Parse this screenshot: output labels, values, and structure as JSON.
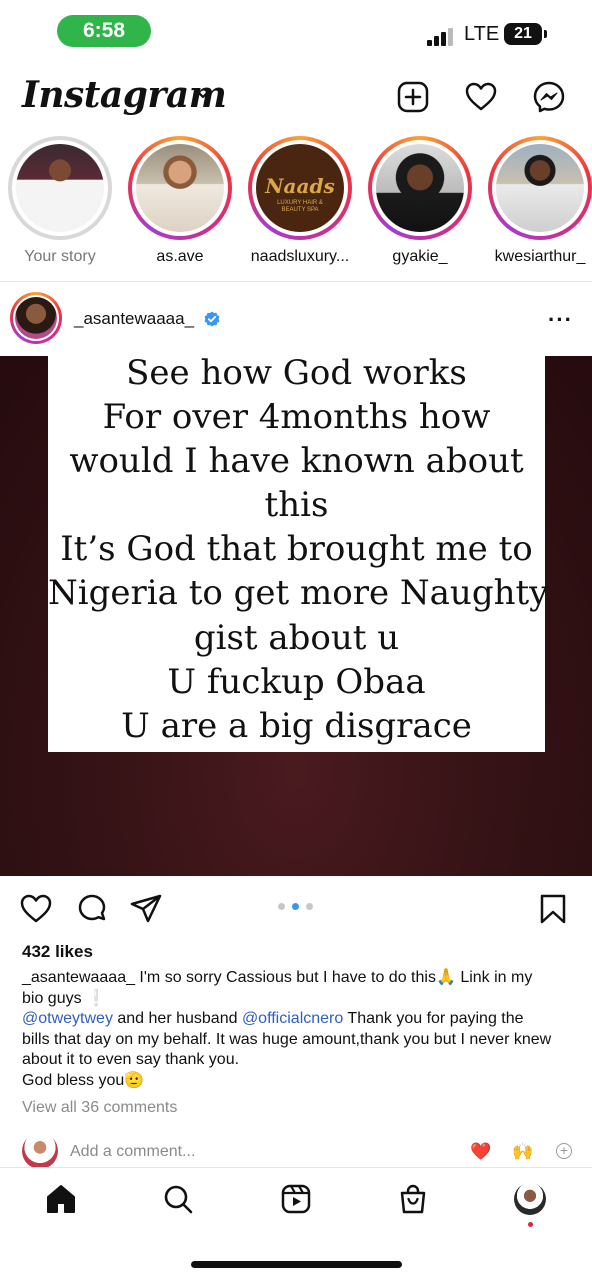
{
  "status_bar": {
    "time": "6:58",
    "network": "LTE",
    "battery": "21",
    "time_pill_color": "#2fb54a"
  },
  "header": {
    "logo": "Instagram",
    "icons": [
      "chevron-down-icon",
      "add-post-icon",
      "heart-icon",
      "messenger-icon"
    ]
  },
  "stories": [
    {
      "name": "Your story",
      "seen": true
    },
    {
      "name": "as.ave",
      "seen": false
    },
    {
      "name": "naadsluxury...",
      "seen": false,
      "avatar_text": "Naads",
      "avatar_subtext": "LUXURY HAIR & BEAUTY SPA"
    },
    {
      "name": "gyakie_",
      "seen": false
    },
    {
      "name": "kwesiarthur_",
      "seen": false
    }
  ],
  "post": {
    "username": "_asantewaaaa_",
    "verified": true,
    "image_text": [
      "See how God works",
      "For over 4months how",
      "would I have known about",
      "this",
      "It’s God that brought me to",
      "Nigeria to get more Naughty",
      "gist about u",
      "U fuckup Obaa",
      "U are a big disgrace"
    ],
    "carousel": {
      "count": 3,
      "active": 1
    },
    "likes": "432 likes",
    "caption": {
      "username": "_asantewaaaa_",
      "line1": " I'm so sorry Cassious but I have to do this🙏 Link in my bio guys ❕",
      "mention1": "@otweytwey",
      "mid": " and her husband ",
      "mention2": "@officialcnero",
      "line2": " Thank you for paying the bills that day on my behalf. It was huge amount,thank you but I never knew about it to even say thank you.",
      "line3": "God bless you🫡"
    },
    "view_comments": "View all 36 comments",
    "add_comment_placeholder": "Add a comment...",
    "quick_emojis": [
      "❤️",
      "🙌"
    ]
  },
  "bottom_nav": [
    "home-icon",
    "search-icon",
    "reels-icon",
    "shop-icon",
    "profile-avatar"
  ],
  "colors": {
    "mention": "#2f5fbf",
    "story_ring": "#d12d8b",
    "post_bg": "#361316",
    "verified": "#3897f0",
    "notification_dot": "#e8203a"
  }
}
